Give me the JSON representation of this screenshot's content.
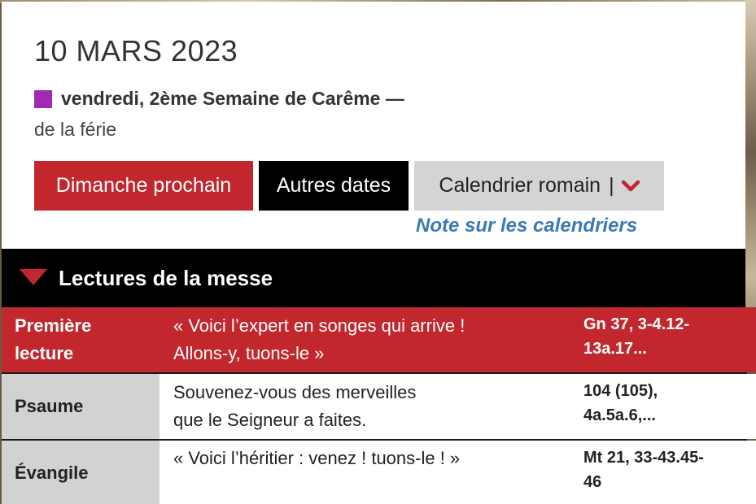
{
  "header": {
    "date": "10 MARS 2023",
    "day": "vendredi, 2ème Semaine de Carême —",
    "feria": "de la férie",
    "liturgical_color": "#a12bb0"
  },
  "buttons": {
    "next_sunday": "Dimanche prochain",
    "other_dates": "Autres dates",
    "calendar": "Calendrier romain",
    "calendar_separator": "|"
  },
  "links": {
    "calendar_note": "Note sur les calendriers"
  },
  "section": {
    "title": "Lectures de la messe"
  },
  "readings": [
    {
      "label_line1": "Première",
      "label_line2": "lecture",
      "title_line1": "« Voici l’expert en songes qui arrive !",
      "title_line2": "Allons-y, tuons-le »",
      "ref_line1": "Gn 37, 3-4.12-",
      "ref_line2": "13a.17..."
    },
    {
      "label_line1": "Psaume",
      "title_line1": "Souvenez-vous des merveilles",
      "title_line2": "que le Seigneur a faites.",
      "ref_line1": "104 (105),",
      "ref_line2": "4a.5a.6,..."
    },
    {
      "label_line1": "Évangile",
      "title_line1": "« Voici l’héritier : venez ! tuons-le ! »",
      "ref_line1": "Mt 21, 33-43.45-",
      "ref_line2": "46"
    }
  ],
  "colors": {
    "accent_red": "#c1272d",
    "link_blue": "#3a7ab6",
    "gray": "#d2d2d2"
  }
}
